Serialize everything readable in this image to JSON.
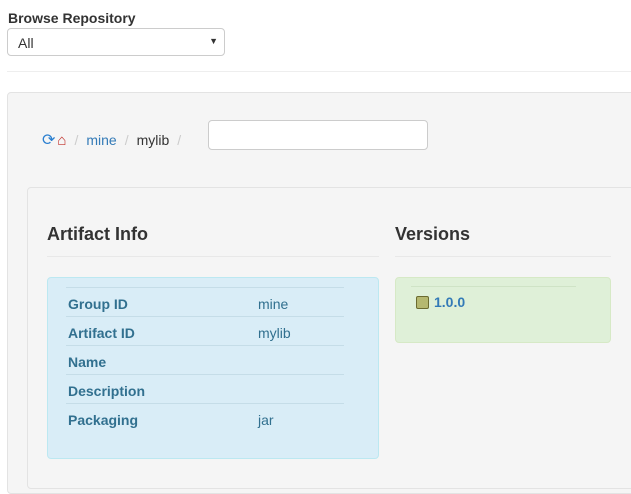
{
  "header": {
    "title": "Browse Repository",
    "repo_select": "All"
  },
  "breadcrumb": {
    "items": [
      "mine",
      "mylib"
    ],
    "path_input": ""
  },
  "artifact_info": {
    "title": "Artifact Info",
    "rows": [
      {
        "key": "Group ID",
        "value": "mine"
      },
      {
        "key": "Artifact ID",
        "value": "mylib"
      },
      {
        "key": "Name",
        "value": ""
      },
      {
        "key": "Description",
        "value": ""
      },
      {
        "key": "Packaging",
        "value": "jar"
      }
    ]
  },
  "versions": {
    "title": "Versions",
    "items": [
      "1.0.0"
    ]
  }
}
